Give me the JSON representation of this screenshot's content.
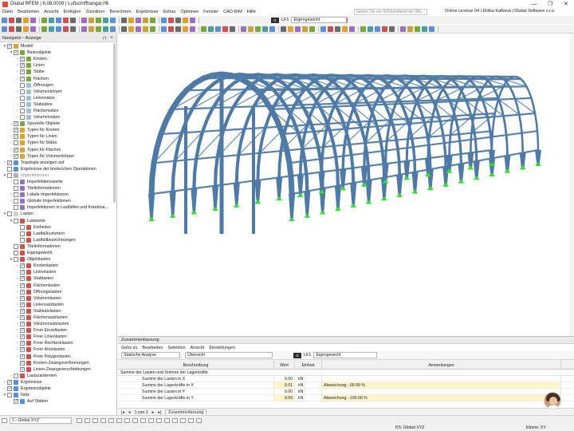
{
  "window": {
    "title": "Dlubal RFEM | 6.08.0009 | Luftschiffhangar.rf6",
    "controls": [
      "—",
      "❐",
      "✕"
    ]
  },
  "menu": {
    "items": [
      "Datei",
      "Bearbeiten",
      "Ansicht",
      "Einfügen",
      "Zuordnen",
      "Berechnen",
      "Ergebnisse",
      "Extras",
      "Optionen",
      "Fenster",
      "CAD-BIM",
      "Hilfe"
    ],
    "search_placeholder": "Geben Sie ein Schlüsselwort ein (Alt...",
    "license": "Online License 04 | Eliška Kafková | Dlubal Software s.r.o."
  },
  "load_case": {
    "type": "G",
    "code": "LF1",
    "name": "Eigengewicht"
  },
  "navigator": {
    "title": "Navigator - Anzeige",
    "items": [
      {
        "label": "Modell",
        "level": 0,
        "arrow": "▾",
        "checked": true,
        "icon": "#e0a030"
      },
      {
        "label": "Basisobjekte",
        "level": 1,
        "arrow": "▾",
        "checked": true,
        "icon": "#7aa63c"
      },
      {
        "label": "Knoten",
        "level": 2,
        "arrow": "›",
        "checked": true,
        "icon": "#7aa63c"
      },
      {
        "label": "Linien",
        "level": 2,
        "arrow": "›",
        "checked": true,
        "icon": "#7aa63c"
      },
      {
        "label": "Stäbe",
        "level": 2,
        "arrow": "›",
        "checked": true,
        "icon": "#7aa63c"
      },
      {
        "label": "Flächen",
        "level": 2,
        "arrow": "›",
        "checked": true,
        "icon": "#7aa63c"
      },
      {
        "label": "Öffnungen",
        "level": 2,
        "arrow": "",
        "checked": false,
        "icon": "#9fbfd9"
      },
      {
        "label": "Volumenkörper",
        "level": 2,
        "arrow": "›",
        "checked": false,
        "icon": "#9fbfd9"
      },
      {
        "label": "Liniensätze",
        "level": 2,
        "arrow": "›",
        "checked": false,
        "icon": "#9fbfd9"
      },
      {
        "label": "Stabsätze",
        "level": 2,
        "arrow": "›",
        "checked": false,
        "icon": "#9fbfd9"
      },
      {
        "label": "Flächensätze",
        "level": 2,
        "arrow": "›",
        "checked": false,
        "icon": "#9fbfd9"
      },
      {
        "label": "Volumensätze",
        "level": 2,
        "arrow": "›",
        "checked": false,
        "icon": "#9fbfd9"
      },
      {
        "label": "Spezielle Objekte",
        "level": 1,
        "arrow": "›",
        "checked": true,
        "icon": "#7aa63c"
      },
      {
        "label": "Typen für Knoten",
        "level": 1,
        "arrow": "›",
        "checked": true,
        "icon": "#e0a030"
      },
      {
        "label": "Typen für Linien",
        "level": 1,
        "arrow": "›",
        "checked": true,
        "icon": "#e0a030"
      },
      {
        "label": "Typen für Stäbe",
        "level": 1,
        "arrow": "›",
        "checked": false,
        "icon": "#e0a030"
      },
      {
        "label": "Typen für Flächen",
        "level": 1,
        "arrow": "›",
        "checked": true,
        "icon": "#e0a030"
      },
      {
        "label": "Typen für Volumenkörper",
        "level": 1,
        "arrow": "›",
        "checked": true,
        "icon": "#e0a030"
      },
      {
        "label": "Topologie anzeigen auf",
        "level": 0,
        "arrow": "›",
        "checked": true,
        "icon": "#5a8fd0"
      },
      {
        "label": "Ergebnisse der booleschen Operationen",
        "level": 0,
        "arrow": "",
        "checked": false,
        "icon": "#5a8fd0"
      },
      {
        "label": "Imperfektionen",
        "level": 0,
        "arrow": "▾",
        "checked": false,
        "icon": "#b0b0b0",
        "muted": true
      },
      {
        "label": "Imperfektionswerte",
        "level": 1,
        "arrow": "›",
        "checked": false,
        "icon": "#9a6fc0"
      },
      {
        "label": "Titelinformationen",
        "level": 1,
        "arrow": "",
        "checked": false,
        "icon": "#9a6fc0"
      },
      {
        "label": "Lokale Imperfektionen",
        "level": 1,
        "arrow": "›",
        "checked": false,
        "icon": "#9a6fc0"
      },
      {
        "label": "Globale Imperfektionen",
        "level": 1,
        "arrow": "›",
        "checked": false,
        "icon": "#9a6fc0"
      },
      {
        "label": "Imperfektionen in Lastfällen und Kombina...",
        "level": 1,
        "arrow": "",
        "checked": false,
        "icon": "#9a6fc0"
      },
      {
        "label": "Lasten",
        "level": 0,
        "arrow": "▾",
        "checked": false,
        "icon": "#d0d0d0"
      },
      {
        "label": "Lastwerte",
        "level": 1,
        "arrow": "▾",
        "checked": false,
        "icon": "#d05050"
      },
      {
        "label": "Einheiten",
        "level": 2,
        "arrow": "",
        "checked": false,
        "icon": "#d05050"
      },
      {
        "label": "Lastfallnummern",
        "level": 2,
        "arrow": "",
        "checked": false,
        "icon": "#d05050"
      },
      {
        "label": "Lastfallbezeichnungen",
        "level": 2,
        "arrow": "",
        "checked": false,
        "icon": "#d05050"
      },
      {
        "label": "Titelinformationen",
        "level": 1,
        "arrow": "",
        "checked": false,
        "icon": "#d05050"
      },
      {
        "label": "Eigengewicht",
        "level": 1,
        "arrow": "",
        "checked": false,
        "icon": "#d05050"
      },
      {
        "label": "Objektlasten",
        "level": 1,
        "arrow": "▾",
        "checked": false,
        "icon": "#d05050"
      },
      {
        "label": "Knotenlasten",
        "level": 2,
        "arrow": "›",
        "checked": true,
        "icon": "#d05050"
      },
      {
        "label": "Linienlasten",
        "level": 2,
        "arrow": "›",
        "checked": true,
        "icon": "#d05050"
      },
      {
        "label": "Stablasten",
        "level": 2,
        "arrow": "›",
        "checked": true,
        "icon": "#d05050"
      },
      {
        "label": "Flächenlasten",
        "level": 2,
        "arrow": "›",
        "checked": true,
        "icon": "#d05050"
      },
      {
        "label": "Öffnungslasten",
        "level": 2,
        "arrow": "›",
        "checked": true,
        "icon": "#d05050"
      },
      {
        "label": "Volumenlasten",
        "level": 2,
        "arrow": "›",
        "checked": true,
        "icon": "#d05050"
      },
      {
        "label": "Liniensatzlasten",
        "level": 2,
        "arrow": "›",
        "checked": true,
        "icon": "#d05050"
      },
      {
        "label": "Stabsatzlasten",
        "level": 2,
        "arrow": "›",
        "checked": true,
        "icon": "#d05050"
      },
      {
        "label": "Flächensatzlasten",
        "level": 2,
        "arrow": "›",
        "checked": true,
        "icon": "#d05050"
      },
      {
        "label": "Volumensatzlasten",
        "level": 2,
        "arrow": "›",
        "checked": true,
        "icon": "#d05050"
      },
      {
        "label": "Freie Einzellasten",
        "level": 2,
        "arrow": "›",
        "checked": true,
        "icon": "#d05050"
      },
      {
        "label": "Freie Linienlasten",
        "level": 2,
        "arrow": "›",
        "checked": true,
        "icon": "#d05050"
      },
      {
        "label": "Freie Rechtecklasten",
        "level": 2,
        "arrow": "›",
        "checked": true,
        "icon": "#d05050"
      },
      {
        "label": "Freie Kreislasten",
        "level": 2,
        "arrow": "›",
        "checked": true,
        "icon": "#d05050"
      },
      {
        "label": "Freie Polygonlasten",
        "level": 2,
        "arrow": "›",
        "checked": true,
        "icon": "#d05050"
      },
      {
        "label": "Knoten-Zwangsverformungen",
        "level": 2,
        "arrow": "",
        "checked": true,
        "icon": "#d05050"
      },
      {
        "label": "Linien-Zwangsverschiebungen",
        "level": 2,
        "arrow": "",
        "checked": true,
        "icon": "#d05050"
      },
      {
        "label": "Lastassistenten",
        "level": 1,
        "arrow": "›",
        "checked": false,
        "icon": "#d05050"
      },
      {
        "label": "Ergebnisse",
        "level": 0,
        "arrow": "›",
        "checked": true,
        "icon": "#5a8fd0"
      },
      {
        "label": "Ergebnisobjekte",
        "level": 0,
        "arrow": "›",
        "checked": true,
        "icon": "#5a8fd0"
      },
      {
        "label": "Netz",
        "level": 0,
        "arrow": "▾",
        "checked": false,
        "icon": "#5a8fd0"
      },
      {
        "label": "Auf Stäben",
        "level": 1,
        "arrow": "",
        "checked": true,
        "icon": "#5a8fd0"
      }
    ]
  },
  "summary": {
    "title": "Zusammenfassung",
    "menu": [
      "Gehe zu",
      "Bearbeiten",
      "Selektion",
      "Ansicht",
      "Einstellungen"
    ],
    "analysis_combo": "Statische Analyse",
    "view_combo": "Übersicht",
    "columns": [
      "Beschreibung",
      "Wert",
      "Einheit",
      "Anmerkungen"
    ],
    "group": "Summe der Lasten und Summe der Lagerkräfte",
    "rows": [
      {
        "desc": "Summe der Lasten in X",
        "value": "0.00",
        "unit": "kN",
        "remark": "",
        "hl": false
      },
      {
        "desc": "Summe der Lagerkräfte in X",
        "value": "0.01",
        "unit": "kN",
        "remark": "Abweichung: -99.99 %",
        "hl": true
      },
      {
        "desc": "Summe der Lasten in Y",
        "value": "0.00",
        "unit": "kN",
        "remark": "",
        "hl": false
      },
      {
        "desc": "Summe der Lagerkräfte in Y",
        "value": "0.09",
        "unit": "kN",
        "remark": "Abweichung: -100.00 %",
        "hl": true
      }
    ],
    "pager": "1 von 1",
    "tab": "Zusammenfassung"
  },
  "status": {
    "view_combo": "1 - Global XYZ",
    "cs": "KS: Global XYZ",
    "plane": "Ebene: XY"
  },
  "colors": {
    "structure": "#4f7aa6",
    "support": "#33dd33",
    "accent": "#1b6fd1"
  }
}
